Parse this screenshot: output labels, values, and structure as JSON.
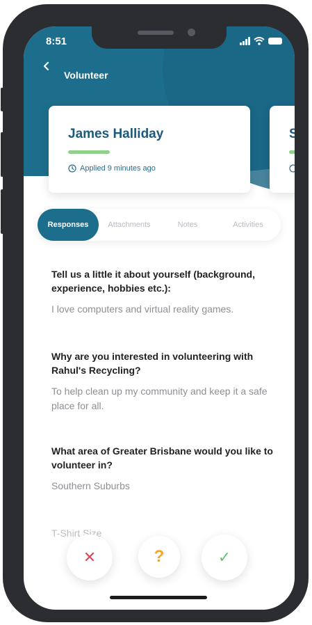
{
  "status_bar": {
    "time": "8:51"
  },
  "header": {
    "title": "Volunteer"
  },
  "applicant_card": {
    "name": "James Halliday",
    "applied": "Applied 9 minutes ago"
  },
  "next_card_initial": "S",
  "tabs": [
    {
      "label": "Responses",
      "active": true
    },
    {
      "label": "Attachments",
      "active": false
    },
    {
      "label": "Notes",
      "active": false
    },
    {
      "label": "Activities",
      "active": false
    }
  ],
  "responses": [
    {
      "question": "Tell us a little it about yourself (background, experience, hobbies etc.):",
      "answer": "I love computers and virtual reality games."
    },
    {
      "question": "Why are you interested in volunteering with Rahul's Recycling?",
      "answer": "To help clean up my community and keep it a safe place for all."
    },
    {
      "question": "What area of Greater Brisbane would you like to volunteer in?",
      "answer": "Southern Suburbs"
    },
    {
      "question": "T-Shirt Size",
      "answer": ""
    }
  ],
  "actions": {
    "reject_glyph": "✕",
    "query_glyph": "?",
    "accept_glyph": "✓"
  },
  "colors": {
    "brand": "#1d6e8c",
    "reject": "#e0455a",
    "query": "#f5a623",
    "accept": "#6bc07a",
    "status_bar_accent": "#8fd08a"
  }
}
